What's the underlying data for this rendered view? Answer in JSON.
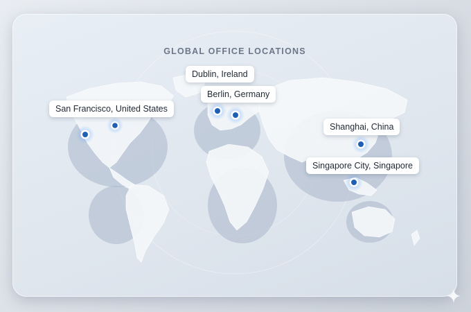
{
  "title": "GLOBAL OFFICE LOCATIONS",
  "colors": {
    "pin": "#1f5fb4",
    "region": "#a9b7cb",
    "land": "#f4f7fa",
    "card": "#e3e9f0"
  },
  "offices": [
    {
      "id": "san-francisco",
      "label": "San Francisco, United States"
    },
    {
      "id": "dublin",
      "label": "Dublin, Ireland"
    },
    {
      "id": "berlin",
      "label": "Berlin, Germany"
    },
    {
      "id": "shanghai",
      "label": "Shanghai, China"
    },
    {
      "id": "singapore",
      "label": "Singapore City, Singapore"
    }
  ],
  "icons": {
    "corner": "sparkle-icon"
  }
}
